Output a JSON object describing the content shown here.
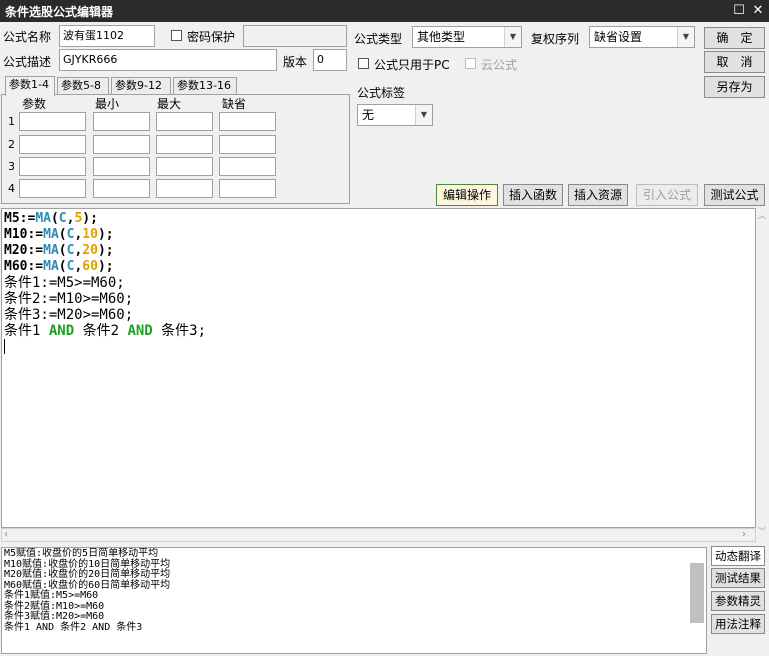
{
  "window": {
    "title": "条件选股公式编辑器",
    "min_icon": "maximize-icon",
    "close_icon": "close-icon"
  },
  "form": {
    "name_label": "公式名称",
    "name_value": "波有蛋1102",
    "password_label": "密码保护",
    "desc_label": "公式描述",
    "desc_value": "GJYKR666",
    "version_label": "版本",
    "version_value": "0",
    "type_label": "公式类型",
    "type_value": "其他类型",
    "rights_label": "复权序列",
    "rights_value": "缺省设置",
    "pc_only_label": "公式只用于PC",
    "cloud_label": "云公式",
    "tag_label": "公式标签",
    "tag_value": "无"
  },
  "buttons": {
    "ok": "确　定",
    "cancel": "取　消",
    "save_as": "另存为",
    "edit_ops": "编辑操作",
    "insert_func": "插入函数",
    "insert_res": "插入资源",
    "import_formula": "引入公式",
    "test_formula": "测试公式"
  },
  "tabs": [
    "参数1-4",
    "参数5-8",
    "参数9-12",
    "参数13-16"
  ],
  "params": {
    "headers": [
      "参数",
      "最小",
      "最大",
      "缺省"
    ],
    "rows": [
      "1",
      "2",
      "3",
      "4"
    ]
  },
  "code": [
    "M5:=MA(C,5);",
    "M10:=MA(C,10);",
    "M20:=MA(C,20);",
    "M60:=MA(C,60);",
    "条件1:=M5>=M60;",
    "条件2:=M10>=M60;",
    "条件3:=M20>=M60;",
    "条件1 AND 条件2 AND 条件3;"
  ],
  "output": [
    "M5赋值:收盘价的5日简单移动平均",
    "M10赋值:收盘价的10日简单移动平均",
    "M20赋值:收盘价的20日简单移动平均",
    "M60赋值:收盘价的60日简单移动平均",
    "条件1赋值:M5>=M60",
    "条件2赋值:M10>=M60",
    "条件3赋值:M20>=M60",
    "条件1 AND 条件2 AND 条件3"
  ],
  "side_buttons": [
    "动态翻译",
    "测试结果",
    "参数精灵",
    "用法注释"
  ]
}
